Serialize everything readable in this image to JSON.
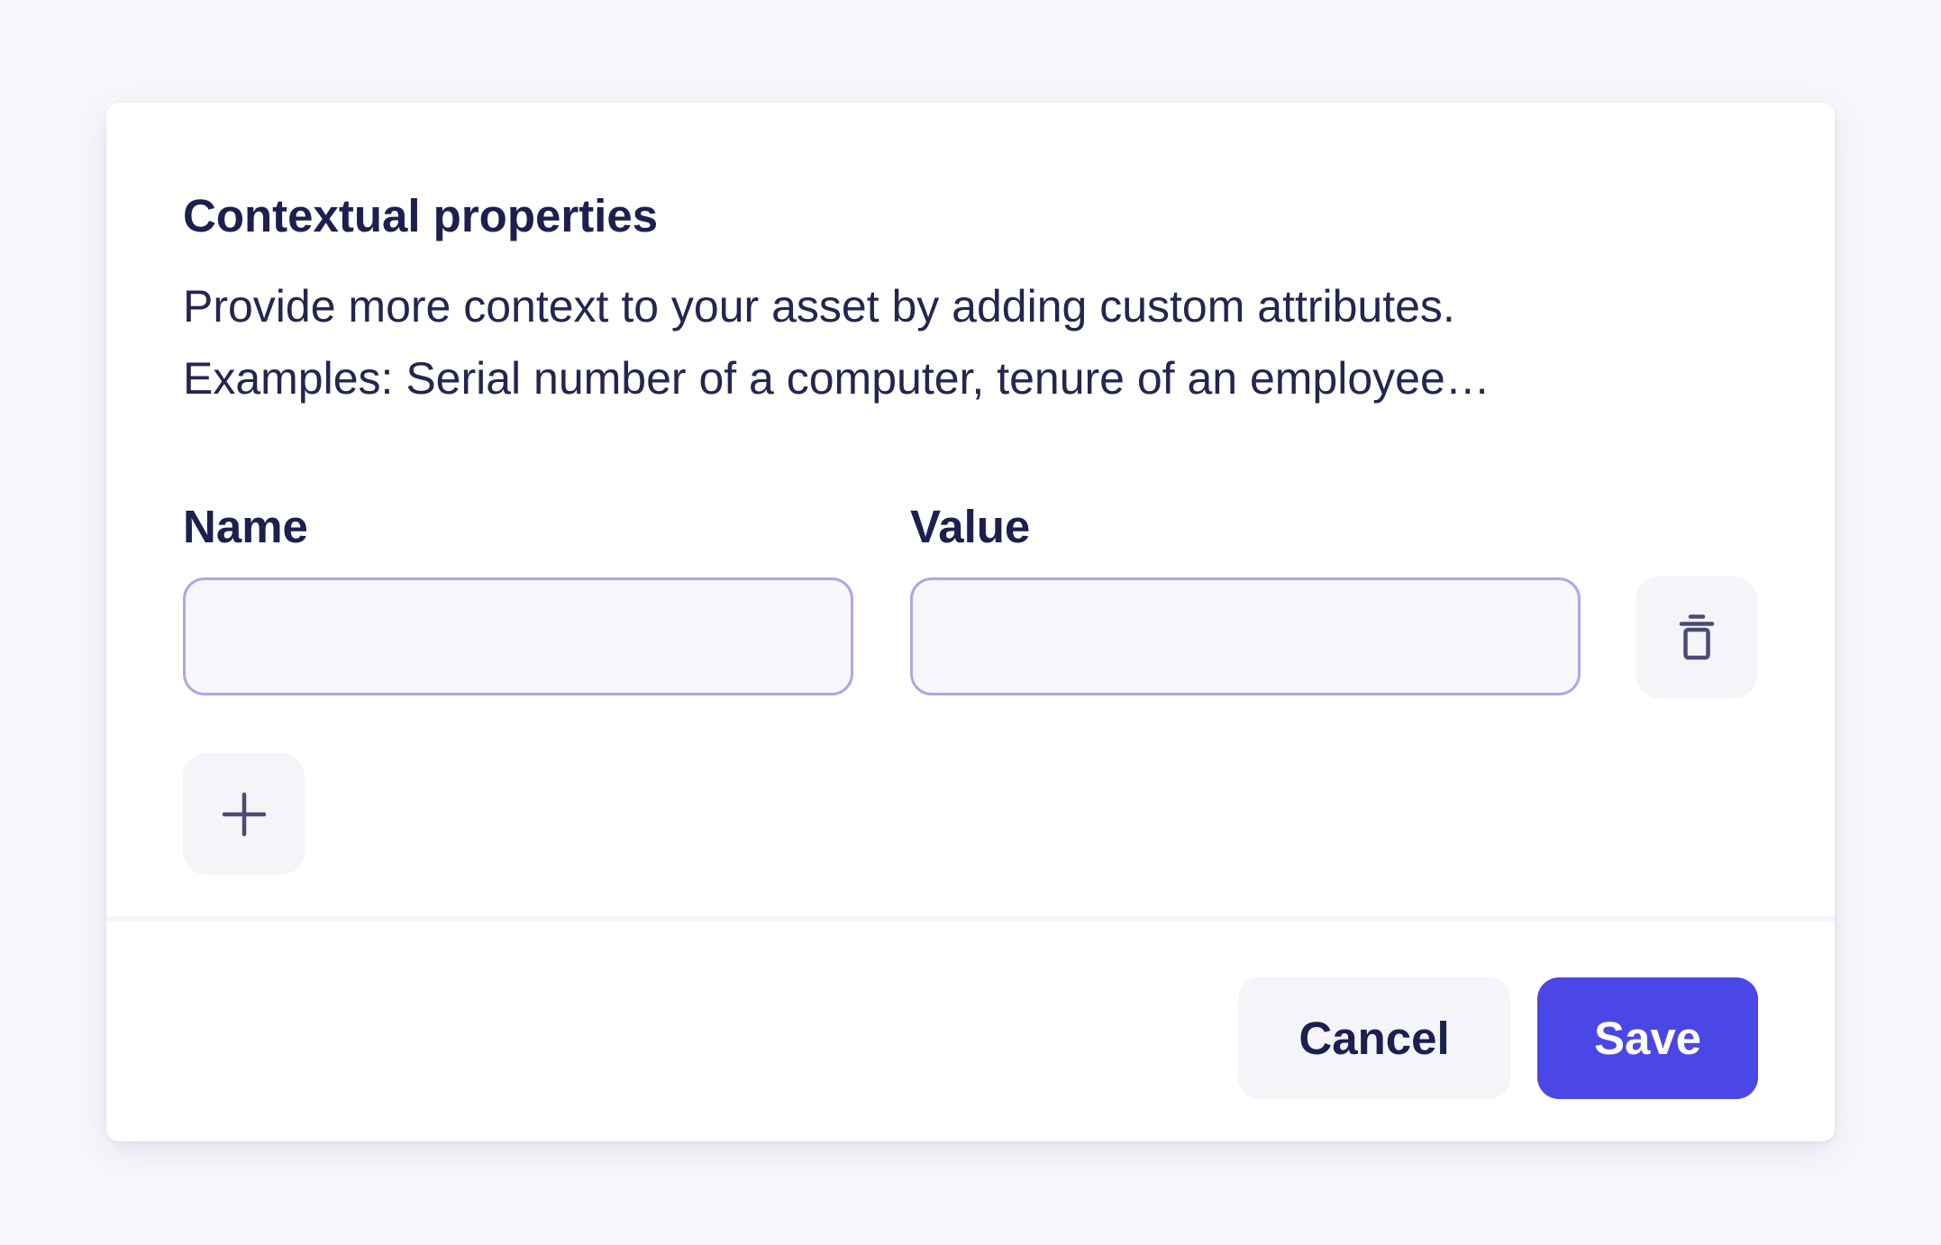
{
  "dialog": {
    "title": "Contextual properties",
    "description_lines": [
      "Provide more context to your asset by adding custom attributes.",
      "Examples: Serial number of a computer, tenure of an employee…"
    ]
  },
  "fields": {
    "name_label": "Name",
    "value_label": "Value",
    "name_value": "",
    "value_value": ""
  },
  "icons": {
    "delete": "trash-icon",
    "add": "plus-icon"
  },
  "footer": {
    "cancel_label": "Cancel",
    "save_label": "Save"
  },
  "colors": {
    "page_background": "#f7f7fb",
    "card_background": "#ffffff",
    "heading_text": "#1c1f4f",
    "input_border": "#aaa8e4",
    "input_fill": "#f6f6fb",
    "icon_button_fill": "#f4f4f9",
    "primary": "#4b47e7"
  }
}
